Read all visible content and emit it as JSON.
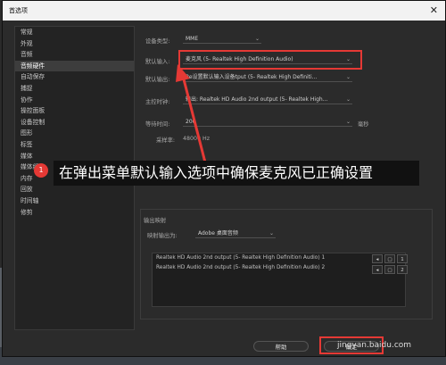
{
  "dialog_title": "首选项",
  "sidebar_items": [
    "常规",
    "外观",
    "音频",
    "音频硬件",
    "自动保存",
    "捕捉",
    "协作",
    "操控面板",
    "设备控制",
    "图形",
    "标签",
    "媒体",
    "媒体缓存",
    "内存",
    "回放",
    "时间轴",
    "修剪"
  ],
  "sidebar_active_index": 3,
  "device_type": {
    "label": "设备类型:",
    "value": "MME"
  },
  "default_input": {
    "label": "默认输入:",
    "value": "麦克风 (5- Realtek High Definition Audio)"
  },
  "default_output": {
    "label": "默认输出:",
    "value": "Re设置默认输入设备tput (5- Realtek High Definiti..."
  },
  "master_clock": {
    "label": "主控时钟:",
    "value": "输出: Realtek HD Audio 2nd output (5- Realtek High..."
  },
  "latency": {
    "label": "等待时间:",
    "value": "200",
    "unit": "毫秒"
  },
  "sample_rate": {
    "label": "采样率:",
    "value": "48000 Hz"
  },
  "output_mapping": {
    "section_label": "输出映射",
    "map_label": "映射输出为:",
    "map_value": "Adobe 桌面音频",
    "rows": [
      "Realtek HD Audio 2nd output (5- Realtek High Definition Audio) 1",
      "Realtek HD Audio 2nd output (5- Realtek High Definition Audio) 2"
    ],
    "channels": [
      "1",
      "2"
    ]
  },
  "buttons": {
    "help": "帮助",
    "ok": "确定"
  },
  "callout": {
    "badge": "1",
    "text": "在弹出菜单默认输入选项中确保麦克风已正确设置"
  },
  "watermark": "jingyan.baidu.com",
  "colors": {
    "highlight": "#e53935",
    "dialog_bg": "#2b2b2b",
    "titlebar_bg": "#f2f2f2"
  }
}
